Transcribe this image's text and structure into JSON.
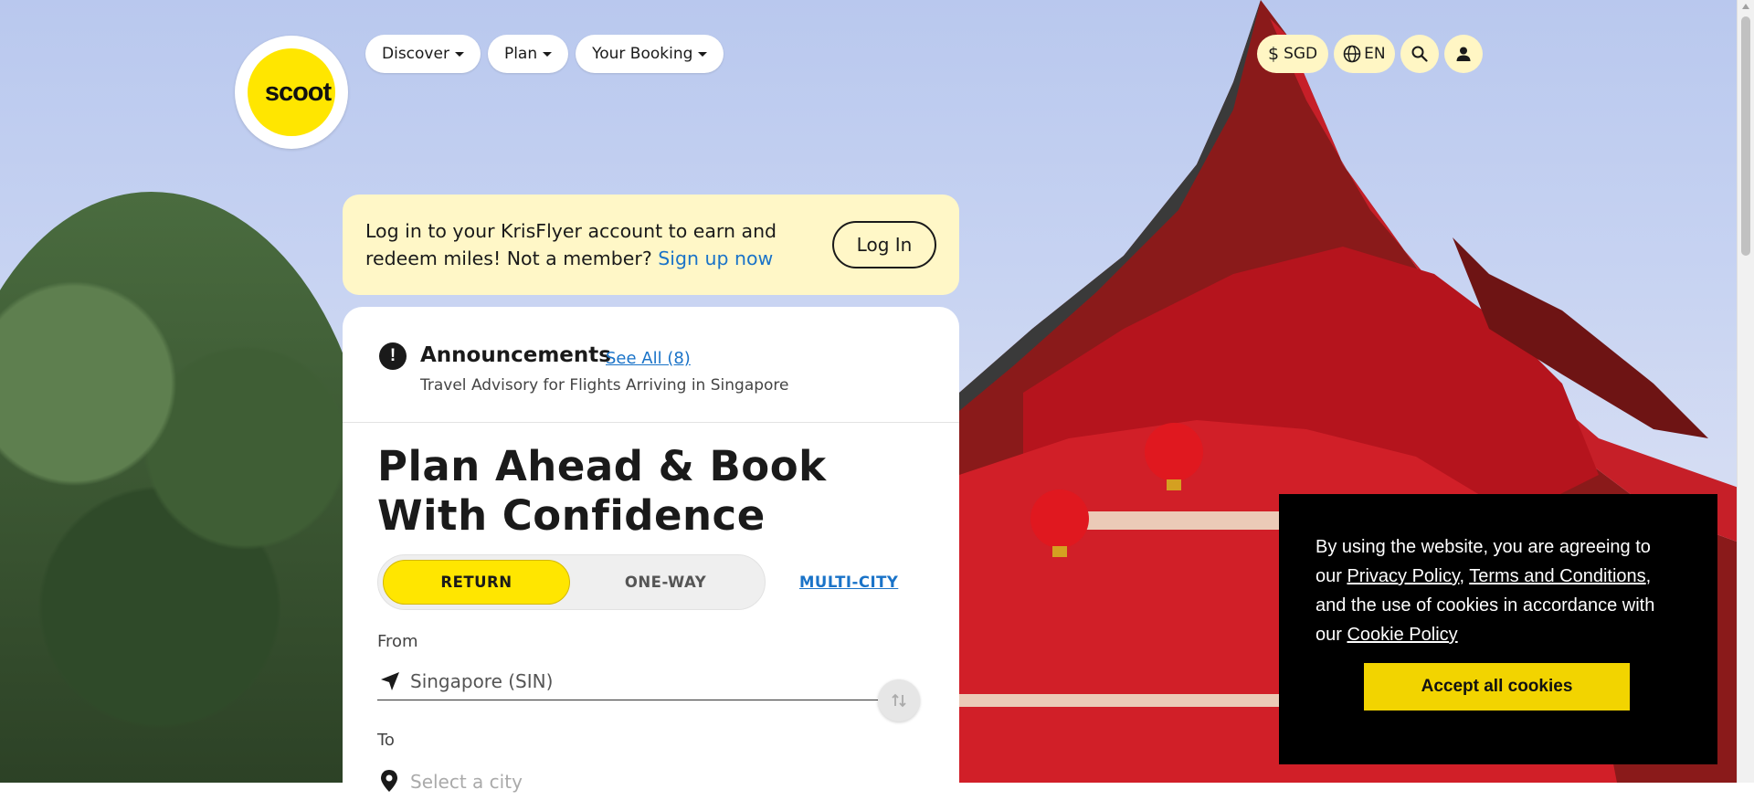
{
  "header": {
    "logo_text": "scoot",
    "nav": [
      {
        "label": "Discover"
      },
      {
        "label": "Plan"
      },
      {
        "label": "Your Booking"
      }
    ],
    "currency": "SGD",
    "language": "EN",
    "icons": [
      "dollar-icon",
      "globe-icon",
      "search-icon",
      "user-icon"
    ]
  },
  "login_banner": {
    "text": "Log in to your KrisFlyer account to earn and redeem miles! Not a member?",
    "signup_link": "Sign up now",
    "button": "Log In"
  },
  "announcements": {
    "title": "Announcements",
    "see_all": "See All (8)",
    "subtitle": "Travel Advisory for Flights Arriving in Singapore"
  },
  "booking": {
    "heading": "Plan Ahead & Book With Confidence",
    "trip_types": [
      "RETURN",
      "ONE-WAY"
    ],
    "selected_trip": "RETURN",
    "multi_city": "MULTI-CITY",
    "from_label": "From",
    "from_value": "Singapore (SIN)",
    "to_label": "To",
    "to_placeholder": "Select a city"
  },
  "cookie_banner": {
    "text_1": "By using the website, you are agreeing to our ",
    "privacy_link": "Privacy Policy",
    "sep": ", ",
    "terms_link": "Terms and Conditions",
    "text_2": ", and the use of cookies in accordance with our ",
    "cookie_link": "Cookie Policy",
    "accept": "Accept all cookies"
  },
  "colors": {
    "brand_yellow": "#ffe600",
    "link_blue": "#1a73c8",
    "banner_bg": "#fff7c7"
  }
}
